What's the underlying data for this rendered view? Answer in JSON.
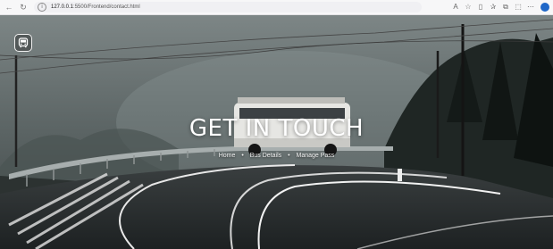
{
  "browser": {
    "back_icon": "back-arrow-icon",
    "refresh_icon": "refresh-icon",
    "url_host": "127.0.0.1",
    "url_path": ":5500/Frontend/contact.html",
    "toolbar_icons": [
      "read-aloud-icon",
      "favorite-star-icon",
      "split-screen-icon",
      "favorites-icon",
      "collections-icon",
      "extensions-icon",
      "more-icon",
      "profile-icon"
    ]
  },
  "header": {
    "logo_icon": "bus-icon"
  },
  "hero": {
    "title": "GET IN TOUCH",
    "breadcrumb": [
      {
        "label": "Home"
      },
      {
        "label": "Bus Details"
      },
      {
        "label": "Manage Pass"
      }
    ],
    "separator": "•"
  }
}
